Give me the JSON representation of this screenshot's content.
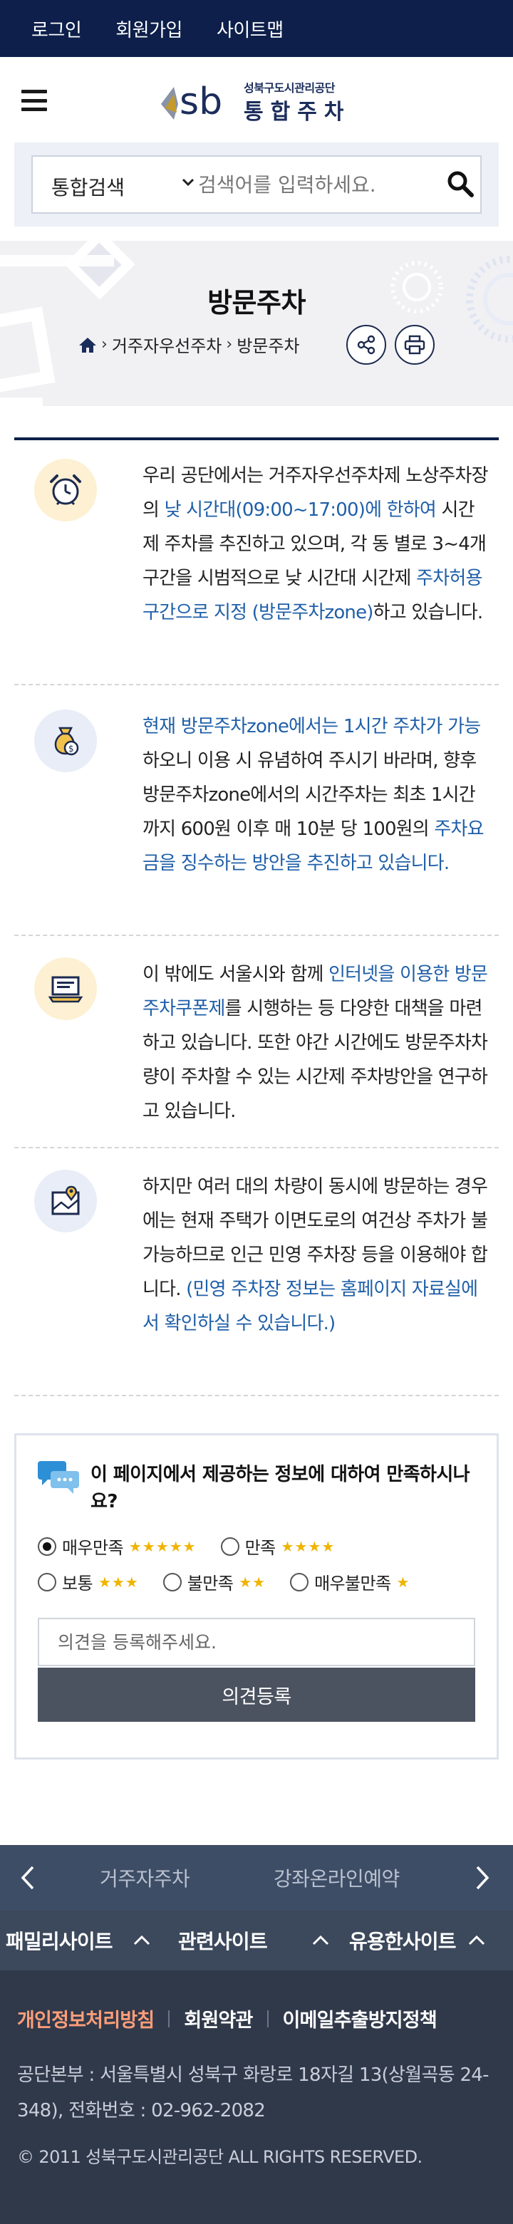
{
  "topbar": {
    "links": [
      "로그인",
      "회원가입",
      "사이트맵"
    ]
  },
  "header": {
    "logo_org": "성북구도시관리공단",
    "logo_name": "통합주차",
    "logo_mark": "sb"
  },
  "search": {
    "scope": "통합검색",
    "placeholder": "검색어를 입력하세요."
  },
  "page": {
    "title": "방문주차",
    "breadcrumb": [
      "거주자우선주차",
      "방문주차"
    ]
  },
  "content": {
    "items": [
      {
        "icon": "alarm-clock-icon",
        "segments": [
          {
            "t": "우리 공단에서는 거주자우선주차제 노상주차장의 ",
            "hl": false
          },
          {
            "t": "낮 시간대(09:00~17:00)에 한하여",
            "hl": true
          },
          {
            "t": " 시간제 주차를 추진하고 있으며, 각 동 별로 3~4개 구간을 시범적으로 낮 시간대 시간제 ",
            "hl": false
          },
          {
            "t": "주차허용구간으로 지정 (방문주차zone)",
            "hl": true
          },
          {
            "t": "하고 있습니다.",
            "hl": false
          }
        ]
      },
      {
        "icon": "money-bag-icon",
        "segments": [
          {
            "t": "현재 방문주차zone에서는 1시간 주차가 가능",
            "hl": true
          },
          {
            "t": "하오니 이용 시 유념하여 주시기 바라며, 향후 방문주차zone에서의 시간주차는 최초 1시간까지 600원 이후 매 10분 당 100원의 ",
            "hl": false
          },
          {
            "t": "주차요금을 징수하는 방안을 추진하고 있습니다.",
            "hl": true
          }
        ]
      },
      {
        "icon": "laptop-coupon-icon",
        "segments": [
          {
            "t": "이 밖에도 서울시와 함께 ",
            "hl": false
          },
          {
            "t": "인터넷을 이용한 방문주차쿠폰제",
            "hl": true
          },
          {
            "t": "를 시행하는 등 다양한 대책을 마련하고 있습니다. 또한 야간 시간에도 방문주차차량이 주차할 수 있는 시간제 주차방안을 연구하고 있습니다.",
            "hl": false
          }
        ]
      },
      {
        "icon": "map-pin-icon",
        "segments": [
          {
            "t": "하지만 여러 대의 차량이 동시에 방문하는 경우에는 현재 주택가 이면도로의 여건상 주차가 불가능하므로 인근 민영 주차장 등을 이용해야 합니다. ",
            "hl": false
          },
          {
            "t": "(민영 주차장 정보는 홈페이지 자료실에서 확인하실 수 있습니다.)",
            "hl": true
          }
        ]
      }
    ]
  },
  "survey": {
    "question": "이 페이지에서 제공하는 정보에 대하여 만족하시나요?",
    "options": [
      {
        "label": "매우만족",
        "stars": "★★★★★",
        "selected": true
      },
      {
        "label": "만족",
        "stars": "★★★★",
        "selected": false
      },
      {
        "label": "보통",
        "stars": "★★★",
        "selected": false
      },
      {
        "label": "불만족",
        "stars": "★★",
        "selected": false
      },
      {
        "label": "매우불만족",
        "stars": "★",
        "selected": false
      }
    ],
    "opinion_placeholder": "의견을 등록해주세요.",
    "submit_label": "의견등록"
  },
  "footer": {
    "slider": [
      "거주자주차",
      "강좌온라인예약"
    ],
    "nav": [
      "패밀리사이트",
      "관련사이트",
      "유용한사이트"
    ],
    "links": [
      "개인정보처리방침",
      "회원약관",
      "이메일추출방지정책"
    ],
    "address": "공단본부 : 서울특별시 성북구 화랑로 18자길 13(상월곡동 24-348), 전화번호 : 02-962-2082",
    "copyright": "© 2011 성북구도시관리공단 ALL RIGHTS RESERVED."
  },
  "colors": {
    "navy": "#0d1f4a",
    "highlight": "#1f5fa8",
    "privacy": "#ff9e7a",
    "star": "#f0b400"
  }
}
